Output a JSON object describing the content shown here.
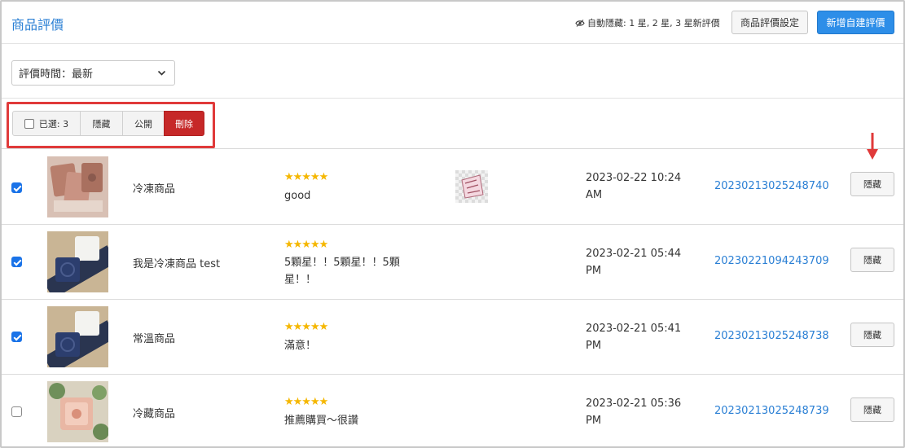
{
  "header": {
    "title": "商品評價",
    "auto_hide_text": "自動隱藏: 1 星, 2 星, 3 星新評價",
    "settings_button": "商品評價設定",
    "new_review_button": "新增自建評價"
  },
  "filter": {
    "sort_label": "評價時間：最新"
  },
  "bulk": {
    "selected_label": "已選: 3",
    "hide_label": "隱藏",
    "public_label": "公開",
    "delete_label": "刪除"
  },
  "colors": {
    "accent": "#2d8ee8",
    "delete": "#c62828",
    "highlight": "#e03a3a",
    "star": "#f5b700"
  },
  "reviews": [
    {
      "checked": true,
      "product_name": "冷凍商品",
      "rating": 5,
      "stars_text": "★★★★★",
      "comment": "good",
      "has_image": true,
      "datetime": "2023-02-22 10:24 AM",
      "order_no": "20230213025248740",
      "action_label": "隱藏"
    },
    {
      "checked": true,
      "product_name": "我是冷凍商品 test",
      "rating": 5,
      "stars_text": "★★★★★",
      "comment": "5顆星！！5顆星！！5顆星！！",
      "has_image": false,
      "datetime": "2023-02-21 05:44 PM",
      "order_no": "20230221094243709",
      "action_label": "隱藏"
    },
    {
      "checked": true,
      "product_name": "常溫商品",
      "rating": 5,
      "stars_text": "★★★★★",
      "comment": "滿意！",
      "has_image": false,
      "datetime": "2023-02-21 05:41 PM",
      "order_no": "20230213025248738",
      "action_label": "隱藏"
    },
    {
      "checked": false,
      "product_name": "冷藏商品",
      "rating": 5,
      "stars_text": "★★★★★",
      "comment": "推薦購買～很讚",
      "has_image": false,
      "datetime": "2023-02-21 05:36 PM",
      "order_no": "20230213025248739",
      "action_label": "隱藏"
    }
  ]
}
